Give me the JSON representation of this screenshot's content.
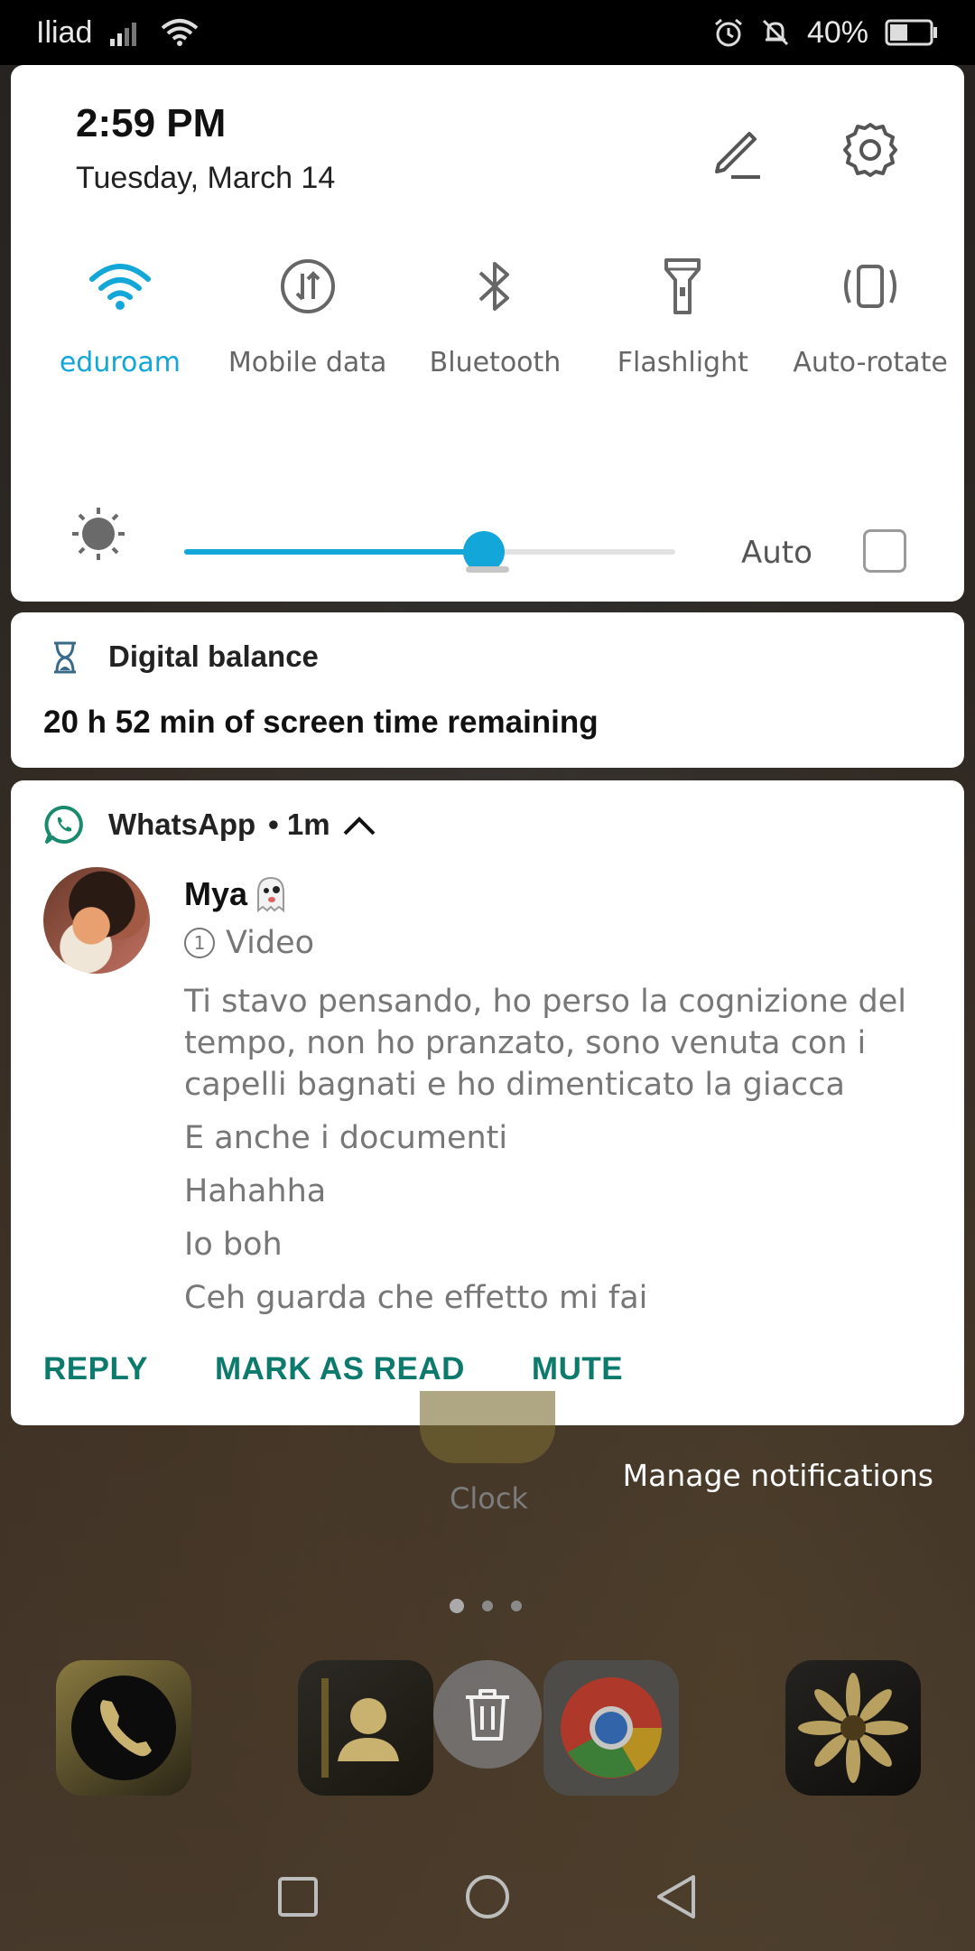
{
  "status_bar": {
    "carrier": "Iliad",
    "battery_percent": "40%",
    "icons": [
      "signal-icon",
      "wifi-icon",
      "alarm-icon",
      "mute-bell-icon",
      "battery-icon"
    ]
  },
  "quick_settings": {
    "time": "2:59 PM",
    "date": "Tuesday, March 14",
    "tiles": [
      {
        "label": "eduroam",
        "icon": "wifi-icon",
        "active": true
      },
      {
        "label": "Mobile data",
        "icon": "mobile-data-icon",
        "active": false
      },
      {
        "label": "Bluetooth",
        "icon": "bluetooth-icon",
        "active": false
      },
      {
        "label": "Flashlight",
        "icon": "flashlight-icon",
        "active": false
      },
      {
        "label": "Auto-rotate",
        "icon": "auto-rotate-icon",
        "active": false
      }
    ],
    "brightness": {
      "level_fraction": 0.61,
      "auto_label": "Auto",
      "auto_checked": false
    },
    "accent_color": "#12a7d8"
  },
  "digital_balance": {
    "title": "Digital balance",
    "text": "20 h 52 min of screen time remaining"
  },
  "whatsapp": {
    "app_name": "WhatsApp",
    "time": "• 1m",
    "sender": "Mya",
    "video_label": "Video",
    "messages": [
      "Ti stavo pensando, ho perso la cognizione del tempo, non ho pranzato, sono venuta con i capelli bagnati e ho dimenticato la giacca",
      "E anche i documenti",
      "Hahahha",
      "Io boh",
      "Ceh guarda che effetto mi fai"
    ],
    "actions": [
      "REPLY",
      "MARK AS READ",
      "MUTE"
    ],
    "action_color": "#0d7a6e"
  },
  "manage_notifications": "Manage notifications",
  "home": {
    "clock_label": "Clock"
  }
}
